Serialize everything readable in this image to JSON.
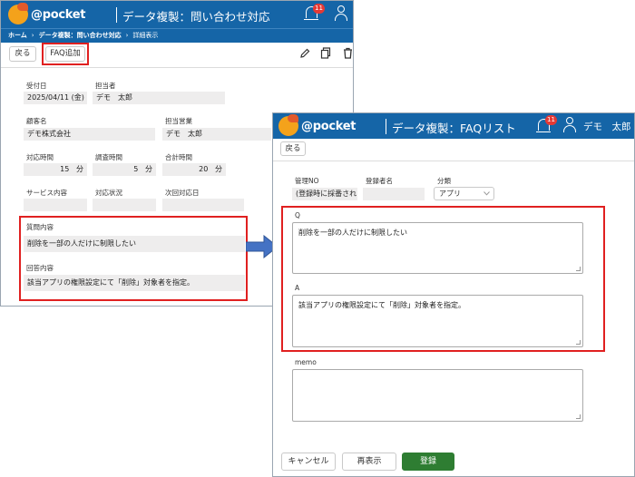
{
  "bg": {
    "logo": "@pocket",
    "title": "データ複製：問い合わせ対応",
    "notify_count": "11",
    "breadcrumb": [
      "ホーム",
      "データ複製：問い合わせ対応",
      "詳細表示"
    ],
    "back_label": "戻る",
    "faq_add_label": "FAQ追加",
    "icons": [
      "edit-icon",
      "copy-icon",
      "trash-icon"
    ],
    "fields": {
      "received_date": {
        "label": "受付日",
        "value": "2025/04/11 (金)"
      },
      "assignee": {
        "label": "担当者",
        "value": "デモ　太郎"
      },
      "customer": {
        "label": "顧客名",
        "value": "デモ株式会社"
      },
      "sales_rep": {
        "label": "担当営業",
        "value": "デモ　太郎"
      },
      "response_time": {
        "label": "対応時間",
        "value": "15",
        "unit": "分"
      },
      "research_time": {
        "label": "調査時間",
        "value": "5",
        "unit": "分"
      },
      "total_time": {
        "label": "合計時間",
        "value": "20",
        "unit": "分"
      },
      "service": {
        "label": "サービス内容"
      },
      "status": {
        "label": "対応状況"
      },
      "next_date": {
        "label": "次回対応日"
      },
      "question": {
        "label": "質問内容",
        "value": "削除を一部の人だけに制限したい"
      },
      "answer": {
        "label": "回答内容",
        "value": "該当アプリの権限設定にて「削除」対象者を指定。"
      }
    }
  },
  "fg": {
    "logo": "@pocket",
    "title": "データ複製：FAQリスト",
    "notify_count": "11",
    "username": "デモ　太郎",
    "back_label": "戻る",
    "mgmt_no": {
      "label": "管理NO",
      "value": "(登録時に採番されま"
    },
    "registrant": {
      "label": "登録者名",
      "value": ""
    },
    "category": {
      "label": "分類",
      "value": "アプリ"
    },
    "q": {
      "label": "Q",
      "value": "削除を一部の人だけに制限したい"
    },
    "a": {
      "label": "A",
      "value": "該当アプリの権限設定にて「削除」対象者を指定。"
    },
    "memo": {
      "label": "memo",
      "value": ""
    },
    "cancel_label": "キャンセル",
    "redisplay_label": "再表示",
    "register_label": "登録"
  },
  "colors": {
    "header": "#1565a7",
    "highlight": "#e02020",
    "arrow": "#4472c4",
    "register": "#2e7d32"
  }
}
